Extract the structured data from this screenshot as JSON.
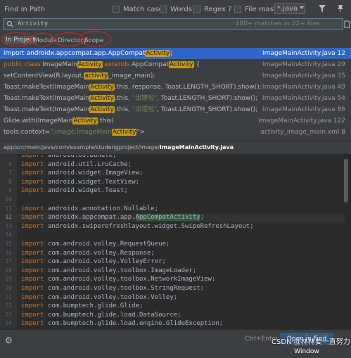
{
  "title": "Find in Path",
  "options": {
    "match_case": "Match case",
    "words": "Words",
    "regex": "Regex ?",
    "file_mask": "File mask:",
    "file_mask_value": "*.java"
  },
  "search": {
    "query": "Activity",
    "match_count": "100+ matches in 22+ files"
  },
  "scope_tabs": [
    "In Project",
    "Module",
    "Directory",
    "Scope"
  ],
  "annotation_color": "#e02020",
  "results": [
    {
      "pre": "import androidx.appcompat.app.AppCompat",
      "hl": "Activity",
      "post": ";",
      "file": "ImageMainActivity.java 12",
      "selected": true
    },
    {
      "kw": "public class ",
      "pre": "ImageMain",
      "hl": "Activity",
      "mid_kw": " extends ",
      "mid": "AppCompat",
      "hl2": "Activity",
      "post": " {",
      "file": "ImageMainActivity.java 29"
    },
    {
      "pre": "setContentView(R.layout.",
      "hl": "activity",
      "post": "_image_main);",
      "file": "ImageMainActivity.java 35"
    },
    {
      "pre": "Toast.makeText(ImageMain",
      "hl": "Activity",
      "post": ".this, response, Toast.LENGTH_SHORT).show();",
      "file": "ImageMainActivity.java 49"
    },
    {
      "pre": "Toast.makeText(ImageMain",
      "hl": "Activity",
      "post": ".this, ",
      "str": "\"出错啦\"",
      "post2": ", Toast.LENGTH_SHORT).show();",
      "file": "ImageMainActivity.java 54"
    },
    {
      "pre": "Toast.makeText(ImageMain",
      "hl": "Activity",
      "post": ".this, ",
      "str": "\"出错啦\"",
      "post2": ", Toast.LENGTH_SHORT).show();",
      "file": "ImageMainActivity.java 86"
    },
    {
      "pre": "Glide.with(ImageMain",
      "hl": "Activity",
      "post": ".this)",
      "file": "ImageMainActivity.java 122"
    },
    {
      "pre": "tools:context=",
      "str": "\".image.ImageMain",
      "hl": "Activity",
      "post": "\">",
      "file": "activity_image_main.xml 8"
    }
  ],
  "path": {
    "dir": "app/src/main/java/com/example/studengproject/image/",
    "file": "ImageMainActivity.java"
  },
  "code": [
    {
      "n": "",
      "t": "import android.os.Bundle;"
    },
    {
      "n": "6",
      "t": "import android.util.LruCache;"
    },
    {
      "n": "7",
      "t": "import android.widget.ImageView;"
    },
    {
      "n": "8",
      "t": "import android.widget.TextView;"
    },
    {
      "n": "9",
      "t": "import android.widget.Toast;"
    },
    {
      "n": "10",
      "t": ""
    },
    {
      "n": "11",
      "t": "import androidx.annotation.Nullable;"
    },
    {
      "n": "12",
      "t": "import androidx.appcompat.app.AppCompatActivity;",
      "h": "AppCompatActivity",
      "cur": true
    },
    {
      "n": "13",
      "t": "import androidx.swiperefreshlayout.widget.SwipeRefreshLayout;"
    },
    {
      "n": "14",
      "t": ""
    },
    {
      "n": "15",
      "t": "import com.android.volley.RequestQueue;"
    },
    {
      "n": "16",
      "t": "import com.android.volley.Response;"
    },
    {
      "n": "17",
      "t": "import com.android.volley.VolleyError;"
    },
    {
      "n": "18",
      "t": "import com.android.volley.toolbox.ImageLoader;"
    },
    {
      "n": "19",
      "t": "import com.android.volley.toolbox.NetworkImageView;"
    },
    {
      "n": "20",
      "t": "import com.android.volley.toolbox.StringRequest;"
    },
    {
      "n": "21",
      "t": "import com.android.volley.toolbox.Volley;"
    },
    {
      "n": "22",
      "t": "import com.bumptech.glide.Glide;"
    },
    {
      "n": "23",
      "t": "import com.bumptech.glide.load.DataSource;"
    },
    {
      "n": "24",
      "t": "import com.bumptech.glide.load.engine.GlideException;"
    }
  ],
  "bottom": {
    "shortcut": "Ctrl+Enter",
    "open_button": "Open in Find Window",
    "watermark": "CSDN @林林要一直努力"
  }
}
